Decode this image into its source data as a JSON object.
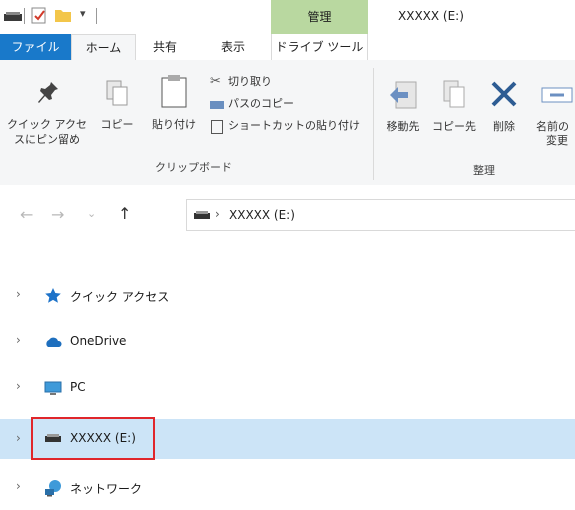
{
  "window": {
    "title": "XXXXX (E:)",
    "contextual_tab": "管理"
  },
  "tabs": {
    "file": "ファイル",
    "home": "ホーム",
    "share": "共有",
    "view": "表示",
    "drive_tools": "ドライブ ツール"
  },
  "ribbon": {
    "pin_label_1": "クイック アクセ",
    "pin_label_2": "スにピン留め",
    "copy": "コピー",
    "paste": "貼り付け",
    "cut": "切り取り",
    "copy_path": "パスのコピー",
    "paste_shortcut": "ショートカットの貼り付け",
    "clipboard_group": "クリップボード",
    "move_to": "移動先",
    "copy_to": "コピー先",
    "delete": "削除",
    "rename_1": "名前の",
    "rename_2": "変更",
    "organize_group": "整理"
  },
  "address": {
    "path": "XXXXX (E:)",
    "separator": "›"
  },
  "nav_pane": [
    {
      "label": "クイック アクセス",
      "icon": "star-icon",
      "expander": "›"
    },
    {
      "label": "OneDrive",
      "icon": "cloud-icon",
      "expander": "›"
    },
    {
      "label": "PC",
      "icon": "monitor-icon",
      "expander": "›"
    },
    {
      "label": "XXXXX (E:)",
      "icon": "drive-icon",
      "expander": "›"
    },
    {
      "label": "ネットワーク",
      "icon": "network-icon",
      "expander": "›"
    }
  ],
  "colors": {
    "file_tab": "#1979ca",
    "manage_tab": "#b9d8a0",
    "selection": "#cce4f7",
    "highlight_border": "#e0262b",
    "pin": "#1e73c9"
  }
}
